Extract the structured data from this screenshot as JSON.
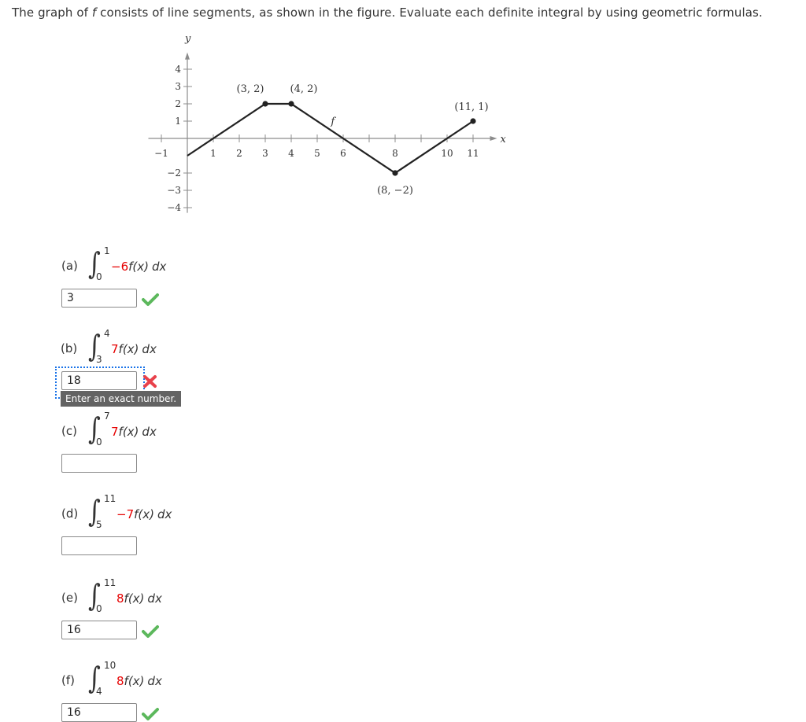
{
  "intro": {
    "before": "The graph of ",
    "fname": "f",
    "after": " consists of line segments, as shown in the figure. Evaluate each definite integral by using geometric formulas."
  },
  "chart_data": {
    "type": "line",
    "title": "",
    "xlabel": "x",
    "ylabel": "y",
    "xlim": [
      -1,
      11.5
    ],
    "ylim": [
      -4,
      4
    ],
    "x_ticks": [
      -1,
      1,
      2,
      3,
      4,
      5,
      6,
      8,
      10,
      11
    ],
    "x_tick_marks": [
      -1,
      1,
      2,
      3,
      4,
      5,
      6,
      7,
      8,
      9,
      10,
      11
    ],
    "y_ticks": [
      -4,
      -3,
      -2,
      1,
      2,
      3,
      4
    ],
    "grid": false,
    "series": [
      {
        "name": "f",
        "points": [
          [
            0,
            -1
          ],
          [
            3,
            2
          ],
          [
            4,
            2
          ],
          [
            8,
            -2
          ],
          [
            11,
            1
          ]
        ]
      }
    ],
    "marked_points": [
      [
        3,
        2
      ],
      [
        4,
        2
      ],
      [
        8,
        -2
      ],
      [
        11,
        1
      ]
    ],
    "annotations": [
      {
        "text": "(3, 2)",
        "x": 3,
        "y": 2,
        "pos": "above-left"
      },
      {
        "text": "(4, 2)",
        "x": 4,
        "y": 2,
        "pos": "above-right"
      },
      {
        "text": "(8, −2)",
        "x": 8,
        "y": -2,
        "pos": "below"
      },
      {
        "text": "(11, 1)",
        "x": 11,
        "y": 1,
        "pos": "above"
      },
      {
        "text": "f",
        "x": 5.6,
        "y": 0.8,
        "pos": "label"
      }
    ]
  },
  "parts": [
    {
      "label": "(a)",
      "lower": "0",
      "upper": "1",
      "coef": "−6",
      "fx": "f(x)",
      "dx": "dx",
      "answer": "3",
      "status": "correct",
      "tooltip": ""
    },
    {
      "label": "(b)",
      "lower": "3",
      "upper": "4",
      "coef": "7",
      "fx": "f(x)",
      "dx": "dx",
      "answer": "18",
      "status": "incorrect",
      "tooltip": "Enter an exact number."
    },
    {
      "label": "(c)",
      "lower": "0",
      "upper": "7",
      "coef": "7",
      "fx": "f(x)",
      "dx": "dx",
      "answer": "",
      "status": "none",
      "tooltip": ""
    },
    {
      "label": "(d)",
      "lower": "5",
      "upper": "11",
      "coef": "−7",
      "fx": "f(x)",
      "dx": "dx",
      "answer": "",
      "status": "none",
      "tooltip": ""
    },
    {
      "label": "(e)",
      "lower": "0",
      "upper": "11",
      "coef": "8",
      "fx": "f(x)",
      "dx": "dx",
      "answer": "16",
      "status": "correct",
      "tooltip": ""
    },
    {
      "label": "(f)",
      "lower": "4",
      "upper": "10",
      "coef": "8",
      "fx": "f(x)",
      "dx": "dx",
      "answer": "16",
      "status": "correct",
      "tooltip": ""
    }
  ],
  "colors": {
    "coefficient": "#e60000",
    "correct": "#5cb85c",
    "incorrect": "#e8414b",
    "focus": "#1a73e8",
    "tooltip_bg": "#636363"
  }
}
